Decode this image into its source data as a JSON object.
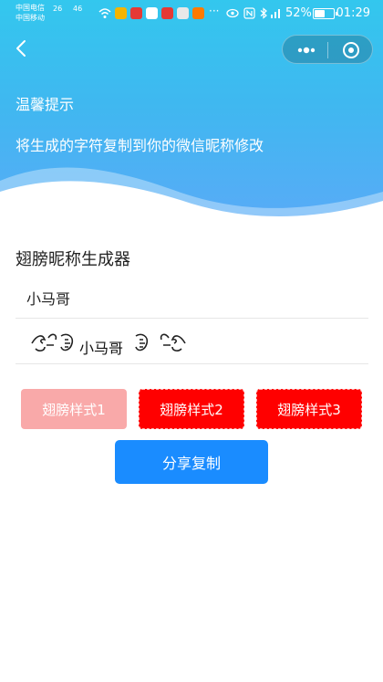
{
  "status_bar": {
    "carrier1": "中国电信",
    "carrier2": "中国移动",
    "net1": "26",
    "net2": "46",
    "battery_text": "52%",
    "battery_level": 0.52,
    "time": "01:29"
  },
  "header": {
    "tip_title": "温馨提示",
    "tip_text": "将生成的字符复制到你的微信昵称修改"
  },
  "generator": {
    "title": "翅膀昵称生成器",
    "input_value": "小马哥",
    "result_text": "小马哥"
  },
  "buttons": {
    "style1": "翅膀样式1",
    "style2": "翅膀样式2",
    "style3": "翅膀样式3",
    "share": "分享复制"
  },
  "colors": {
    "header_top": "#33c7ee",
    "header_bottom": "#5aaaf7",
    "style1_bg": "#f9a9a9",
    "style_active_bg": "#ff0000",
    "share_bg": "#1a8cff"
  }
}
